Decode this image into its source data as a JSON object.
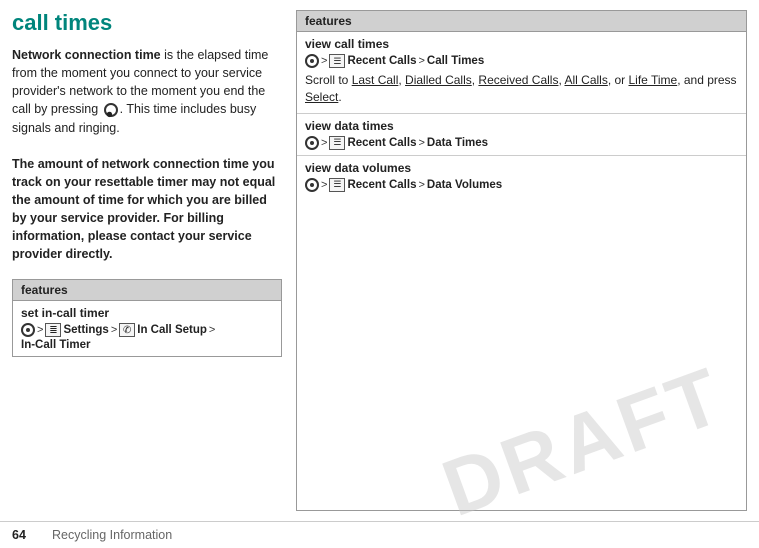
{
  "page": {
    "title": "call times",
    "watermark": "DRAFT"
  },
  "left": {
    "paragraph1_strong": "Network connection time",
    "paragraph1_rest": " is the elapsed time from the moment you connect to your service provider's network to the moment you end the call by pressing ",
    "paragraph1_end": ". This time includes busy signals and ringing.",
    "paragraph2": "The amount of network connection time you track on your resettable timer may not equal the amount of time for which you are billed by your service provider. For billing information, please contact your service provider directly.",
    "features_header": "features",
    "feature1_label": "set in-call timer",
    "feature1_nav": "s > ",
    "feature1_icon1": "⊞",
    "feature1_path1": "Settings",
    "feature1_gt1": ">",
    "feature1_icon2": "✆",
    "feature1_path2": "In Call Setup",
    "feature1_gt2": ">",
    "feature1_dest": "In-Call Timer"
  },
  "right": {
    "features_header": "features",
    "section1_label": "view call times",
    "section1_nav": "s > ",
    "section1_icon": "☰",
    "section1_path1": "Recent Calls",
    "section1_gt": ">",
    "section1_dest": "Call Times",
    "section1_scroll": "Scroll to ",
    "section1_last_call": "Last Call",
    "section1_comma1": ", ",
    "section1_dialled": "Dialled Calls",
    "section1_comma2": ", ",
    "section1_received": "Received Calls",
    "section1_comma3": ", ",
    "section1_all": "All Calls",
    "section1_or": ", or ",
    "section1_lifetime": "Life Time",
    "section1_end": ", and press ",
    "section1_select": "Select",
    "section1_dot": ".",
    "section2_label": "view data times",
    "section2_nav": "s > ",
    "section2_icon": "☰",
    "section2_path1": "Recent Calls",
    "section2_gt": ">",
    "section2_dest": "Data Times",
    "section3_label": "view data volumes",
    "section3_nav": "s > ",
    "section3_icon": "☰",
    "section3_path1": "Recent Calls",
    "section3_gt": ">",
    "section3_dest": "Data Volumes"
  },
  "footer": {
    "page_number": "64",
    "text": "Recycling Information"
  }
}
